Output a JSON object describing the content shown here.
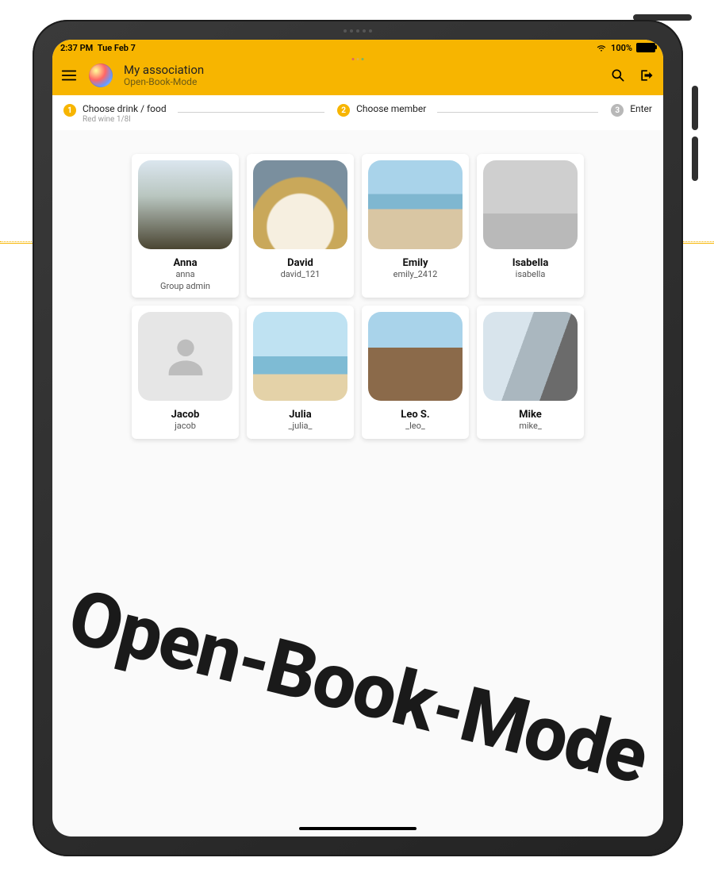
{
  "status": {
    "time": "2:37 PM",
    "date": "Tue Feb 7",
    "battery": "100%"
  },
  "header": {
    "title": "My association",
    "subtitle": "Open-Book-Mode"
  },
  "stepper": {
    "s1": {
      "num": "1",
      "label": "Choose drink / food",
      "sub": "Red wine 1/8l"
    },
    "s2": {
      "num": "2",
      "label": "Choose member"
    },
    "s3": {
      "num": "3",
      "label": "Enter"
    }
  },
  "members": [
    {
      "name": "Anna",
      "user": "anna",
      "role": "Group admin",
      "thumb": "anna"
    },
    {
      "name": "David",
      "user": "david_121",
      "role": "",
      "thumb": "david"
    },
    {
      "name": "Emily",
      "user": "emily_2412",
      "role": "",
      "thumb": "emily"
    },
    {
      "name": "Isabella",
      "user": "isabella",
      "role": "",
      "thumb": "isabella"
    },
    {
      "name": "Jacob",
      "user": "jacob",
      "role": "",
      "thumb": "placeholder"
    },
    {
      "name": "Julia",
      "user": "_julia_",
      "role": "",
      "thumb": "julia"
    },
    {
      "name": "Leo S.",
      "user": "_leo_",
      "role": "",
      "thumb": "leo"
    },
    {
      "name": "Mike",
      "user": "mike_",
      "role": "",
      "thumb": "mike"
    }
  ],
  "watermark": "Open-Book-Mode"
}
